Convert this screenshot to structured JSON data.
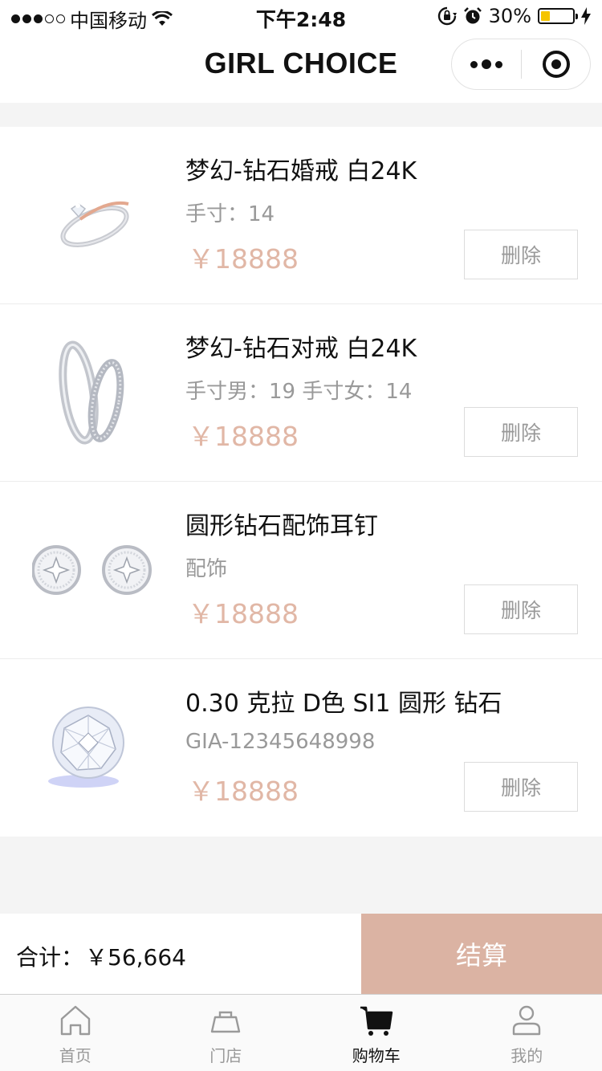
{
  "status_bar": {
    "carrier": "中国移动",
    "time": "下午2:48",
    "battery_percent": "30%",
    "battery_level": 0.3
  },
  "nav": {
    "title": "GIRL CHOICE"
  },
  "cart": {
    "items": [
      {
        "title": "梦幻-钻石婚戒 白24K",
        "spec": "手寸：14",
        "price": "￥18888",
        "delete_label": "删除",
        "image": "ring-icon"
      },
      {
        "title": "梦幻-钻石对戒 白24K",
        "spec": "手寸男：19 手寸女：14",
        "price": "￥18888",
        "delete_label": "删除",
        "image": "couple-rings-icon"
      },
      {
        "title": "圆形钻石配饰耳钉",
        "spec": "配饰",
        "price": "￥18888",
        "delete_label": "删除",
        "image": "earrings-icon"
      },
      {
        "title": "0.30 克拉 D色 SI1 圆形 钻石",
        "spec": "GIA-12345648998",
        "price": "￥18888",
        "delete_label": "删除",
        "image": "diamond-icon"
      }
    ]
  },
  "summary": {
    "total_label": "合计：",
    "total_value": "￥56,664",
    "checkout_label": "结算"
  },
  "tabbar": {
    "tabs": [
      {
        "label": "首页",
        "icon": "home-icon"
      },
      {
        "label": "门店",
        "icon": "store-icon"
      },
      {
        "label": "购物车",
        "icon": "cart-icon",
        "active": true
      },
      {
        "label": "我的",
        "icon": "user-icon"
      }
    ]
  },
  "colors": {
    "accent": "#dbb3a3",
    "price": "#e1b7a6",
    "muted": "#999999",
    "battery": "#f5c400"
  }
}
